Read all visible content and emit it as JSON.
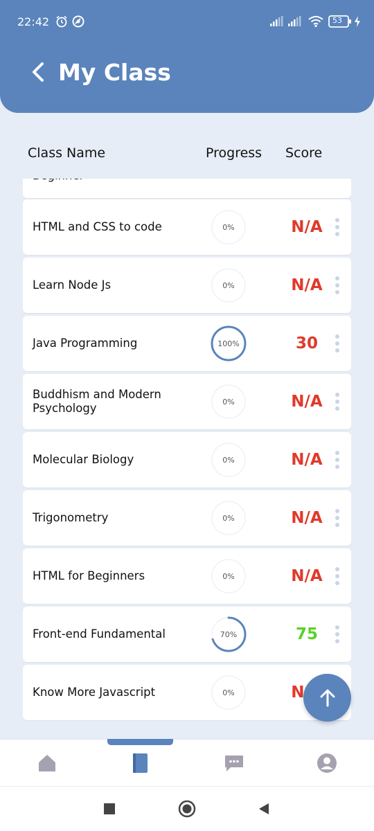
{
  "status_bar": {
    "time": "22:42",
    "battery": "53",
    "icons": [
      "alarm-icon",
      "vpn-icon",
      "signal-icon",
      "signal-icon",
      "wifi-icon",
      "battery-icon",
      "charging-icon"
    ]
  },
  "header": {
    "back_icon": "chevron-left-icon",
    "title": "My Class",
    "background": "#5a84bb"
  },
  "columns": {
    "name": "Class Name",
    "progress": "Progress",
    "score": "Score"
  },
  "partial_row": {
    "name": "Beginner"
  },
  "classes": [
    {
      "name": "HTML and CSS to code",
      "progress_label": "0%",
      "progress": 0,
      "score": "N/A",
      "score_color": "#e03a2b"
    },
    {
      "name": "Learn Node Js",
      "progress_label": "0%",
      "progress": 0,
      "score": "N/A",
      "score_color": "#e03a2b"
    },
    {
      "name": "Java Programming",
      "progress_label": "100%",
      "progress": 1.0,
      "score": "30",
      "score_color": "#e03a2b"
    },
    {
      "name": "Buddhism and Modern Psychology",
      "progress_label": "0%",
      "progress": 0,
      "score": "N/A",
      "score_color": "#e03a2b"
    },
    {
      "name": "Molecular Biology",
      "progress_label": "0%",
      "progress": 0,
      "score": "N/A",
      "score_color": "#e03a2b"
    },
    {
      "name": "Trigonometry",
      "progress_label": "0%",
      "progress": 0,
      "score": "N/A",
      "score_color": "#e03a2b"
    },
    {
      "name": "HTML for Beginners",
      "progress_label": "0%",
      "progress": 0,
      "score": "N/A",
      "score_color": "#e03a2b"
    },
    {
      "name": "Front-end Fundamental",
      "progress_label": "70%",
      "progress": 0.7,
      "score": "75",
      "score_color": "#5ad22a"
    },
    {
      "name": "Know More Javascript",
      "progress_label": "0%",
      "progress": 0,
      "score": "N/A",
      "score_color": "#e03a2b"
    }
  ],
  "fab": {
    "icon": "arrow-up-icon"
  },
  "bottom_nav": {
    "items": [
      {
        "icon": "home-icon",
        "active": false
      },
      {
        "icon": "book-icon",
        "active": true
      },
      {
        "icon": "chat-icon",
        "active": false
      },
      {
        "icon": "profile-icon",
        "active": false
      }
    ],
    "active_color": "#5a84bb",
    "inactive_color": "#a6a1b0"
  },
  "system_nav": {
    "items": [
      "recents-icon",
      "home-circle-icon",
      "back-triangle-icon"
    ]
  }
}
